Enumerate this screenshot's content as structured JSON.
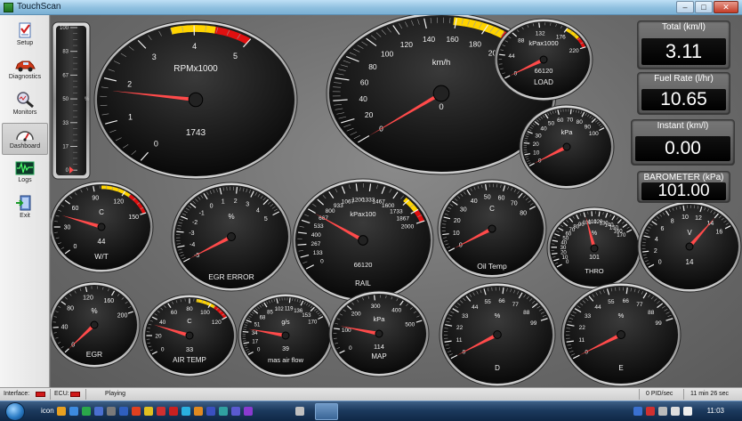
{
  "window": {
    "title": "TouchScan",
    "min_label": "–",
    "max_label": "□",
    "close_label": "✕"
  },
  "sidebar": {
    "items": [
      {
        "label": "Setup",
        "icon": "checklist-icon"
      },
      {
        "label": "Diagnostics",
        "icon": "car-icon"
      },
      {
        "label": "Monitors",
        "icon": "magnifier-icon"
      },
      {
        "label": "Dashboard",
        "icon": "speedometer-icon",
        "active": true
      },
      {
        "label": "Logs",
        "icon": "waveform-icon"
      },
      {
        "label": "Exit",
        "icon": "exit-door-icon"
      }
    ]
  },
  "bar_gauge": {
    "ticks": [
      "100",
      "83",
      "67",
      "50",
      "33",
      "17",
      "0"
    ],
    "unit": "%",
    "level": 0
  },
  "gauges": [
    {
      "id": "rpm",
      "label": "RPMx1000",
      "value": "1743",
      "ticks": [
        "0",
        "1",
        "2",
        "3",
        "4",
        "5"
      ],
      "min": 0,
      "max": 5,
      "reading": 1.743
    },
    {
      "id": "speed",
      "label": "km/h",
      "value": "0",
      "ticks": [
        "0",
        "20",
        "40",
        "60",
        "80",
        "100",
        "120",
        "140",
        "160",
        "180",
        "200",
        "220"
      ],
      "min": 0,
      "max": 220,
      "reading": 0
    },
    {
      "id": "kpax1000",
      "label": "kPax1000",
      "value": "66120",
      "caption": "LOAD",
      "ticks": [
        "0",
        "44",
        "88",
        "132",
        "176",
        "220"
      ],
      "min": 0,
      "max": 220,
      "reading": 0
    },
    {
      "id": "kpa",
      "label": "kPa",
      "value": "",
      "ticks": [
        "0",
        "10",
        "20",
        "30",
        "40",
        "50",
        "60",
        "70",
        "80",
        "90",
        "100"
      ],
      "min": 0,
      "max": 100,
      "reading": 0
    },
    {
      "id": "wt",
      "label": "C",
      "value": "44",
      "caption": "W/T",
      "ticks": [
        "0",
        "30",
        "60",
        "90",
        "120",
        "150"
      ],
      "min": 0,
      "max": 150,
      "reading": 44
    },
    {
      "id": "egr-error",
      "label": "%",
      "value": "",
      "caption": "EGR ERROR",
      "ticks": [
        "-5",
        "-4",
        "-3",
        "-2",
        "-1",
        "0",
        "1",
        "2",
        "3",
        "4",
        "5"
      ],
      "min": -5,
      "max": 5,
      "reading": -5
    },
    {
      "id": "rail",
      "label": "kPax100",
      "value": "66120",
      "caption": "RAIL",
      "ticks": [
        "0",
        "133",
        "267",
        "400",
        "533",
        "667",
        "800",
        "933",
        "1067",
        "1200",
        "1333",
        "1467",
        "1600",
        "1733",
        "1867",
        "2000"
      ],
      "min": 0,
      "max": 2000,
      "reading": 661
    },
    {
      "id": "oil-temp",
      "label": "C",
      "value": "",
      "caption": "Oil Temp",
      "ticks": [
        "0",
        "10",
        "20",
        "30",
        "40",
        "50",
        "60",
        "70",
        "80"
      ],
      "min": 0,
      "max": 80,
      "reading": 0
    },
    {
      "id": "thro",
      "label": "%",
      "value": "101",
      "caption": "THRO",
      "ticks": [
        "0",
        "10",
        "20",
        "30",
        "40",
        "50",
        "60",
        "70",
        "80",
        "90",
        "100",
        "110",
        "120",
        "130",
        "140",
        "150",
        "160",
        "170"
      ],
      "min": 0,
      "max": 170,
      "reading": 101
    },
    {
      "id": "volt",
      "label": "V",
      "value": "14",
      "ticks": [
        "0",
        "2",
        "4",
        "6",
        "8",
        "10",
        "12",
        "14",
        "16"
      ],
      "min": 0,
      "max": 16,
      "reading": 14
    },
    {
      "id": "egr",
      "label": "%",
      "value": "",
      "caption": "EGR",
      "ticks": [
        "0",
        "40",
        "80",
        "120",
        "160",
        "200"
      ],
      "min": 0,
      "max": 200,
      "reading": 0
    },
    {
      "id": "air-temp",
      "label": "C",
      "value": "33",
      "caption": "AIR TEMP",
      "ticks": [
        "0",
        "20",
        "40",
        "60",
        "80",
        "100",
        "120"
      ],
      "min": 0,
      "max": 120,
      "reading": 33
    },
    {
      "id": "mass-air-flow",
      "label": "g/s",
      "value": "39",
      "caption": "mas air flow",
      "ticks": [
        "0",
        "17",
        "34",
        "51",
        "68",
        "85",
        "102",
        "119",
        "136",
        "153",
        "170"
      ],
      "min": 0,
      "max": 170,
      "reading": 39
    },
    {
      "id": "map",
      "label": "kPa",
      "value": "114",
      "caption": "MAP",
      "ticks": [
        "0",
        "100",
        "200",
        "300",
        "400",
        "500"
      ],
      "min": 0,
      "max": 500,
      "reading": 114
    },
    {
      "id": "pct-d",
      "label": "%",
      "value": "",
      "caption": "D",
      "ticks": [
        "0",
        "11",
        "22",
        "33",
        "44",
        "55",
        "66",
        "77",
        "88",
        "99"
      ],
      "min": 0,
      "max": 99,
      "reading": 0
    },
    {
      "id": "pct-e",
      "label": "%",
      "value": "",
      "caption": "E",
      "ticks": [
        "0",
        "11",
        "22",
        "33",
        "44",
        "55",
        "66",
        "77",
        "88",
        "99"
      ],
      "min": 0,
      "max": 99,
      "reading": 0
    }
  ],
  "readouts": [
    {
      "label": "Total (km/l)",
      "value": "3.11"
    },
    {
      "label": "Fuel Rate (l/hr)",
      "value": "10.65"
    },
    {
      "label": "Instant (km/l)",
      "value": "0.00"
    },
    {
      "label": "BAROMETER (kPa)",
      "value": "101.00"
    }
  ],
  "status": {
    "interface_label": "Interface:",
    "ecu_label": "ECU:",
    "state": "Playing",
    "pid_rate": "0 PID/sec",
    "elapsed": "11 min 26 sec",
    "led_color": "#d01818"
  },
  "taskbar": {
    "label": "icon",
    "clock": "11:03"
  },
  "colors": {
    "needle": "#ff4a4a",
    "zone_yellow": "#ffd400",
    "zone_red": "#e01010"
  }
}
